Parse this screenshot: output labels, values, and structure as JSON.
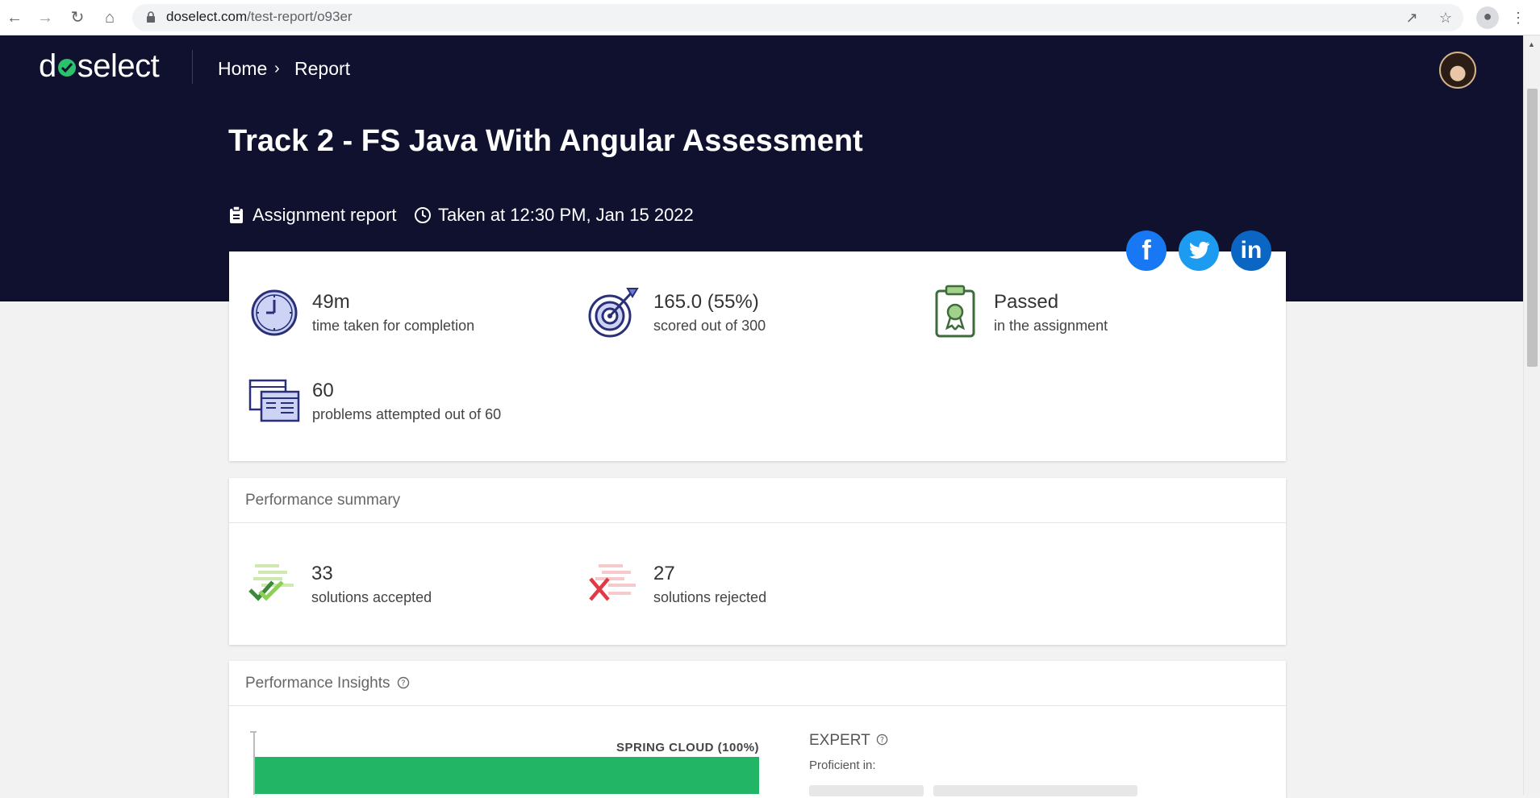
{
  "browser": {
    "url_domain": "doselect.com",
    "url_path": "/test-report/o93er"
  },
  "header": {
    "logo_left": "d",
    "logo_right": "select",
    "breadcrumb": [
      "Home",
      "Report"
    ]
  },
  "report": {
    "title": "Track 2 - FS Java With Angular Assessment",
    "type_label": "Assignment report",
    "taken_label": "Taken at 12:30 PM, Jan 15 2022"
  },
  "social": [
    "facebook",
    "twitter",
    "linkedin"
  ],
  "stats": {
    "time": {
      "value": "49m",
      "label": "time taken for completion"
    },
    "score": {
      "value": "165.0 (55%)",
      "label": "scored out of 300"
    },
    "result": {
      "value": "Passed",
      "label": "in the assignment"
    },
    "problems": {
      "value": "60",
      "label": "problems attempted out of 60"
    }
  },
  "performance_summary": {
    "title": "Performance summary",
    "accepted": {
      "value": "33",
      "label": "solutions accepted"
    },
    "rejected": {
      "value": "27",
      "label": "solutions rejected"
    }
  },
  "insights": {
    "title": "Performance Insights",
    "bar_label": "SPRING CLOUD (100%)",
    "bar_percent": 100,
    "level": "EXPERT",
    "proficient_label": "Proficient in:"
  },
  "colors": {
    "hero_bg": "#0f112e",
    "accent_green": "#2cc16c",
    "bar_green": "#22b566",
    "facebook": "#1877f2",
    "twitter": "#1d9bf0",
    "linkedin": "#0a66c2"
  },
  "icons": [
    "back-icon",
    "forward-icon",
    "reload-icon",
    "home-icon",
    "lock-icon",
    "share-icon",
    "star-icon",
    "profile-icon",
    "menu-icon",
    "clipboard-icon",
    "clock-icon",
    "stopwatch-icon",
    "target-icon",
    "certificate-icon",
    "documents-icon",
    "double-check-icon",
    "cross-icon",
    "help-icon"
  ]
}
